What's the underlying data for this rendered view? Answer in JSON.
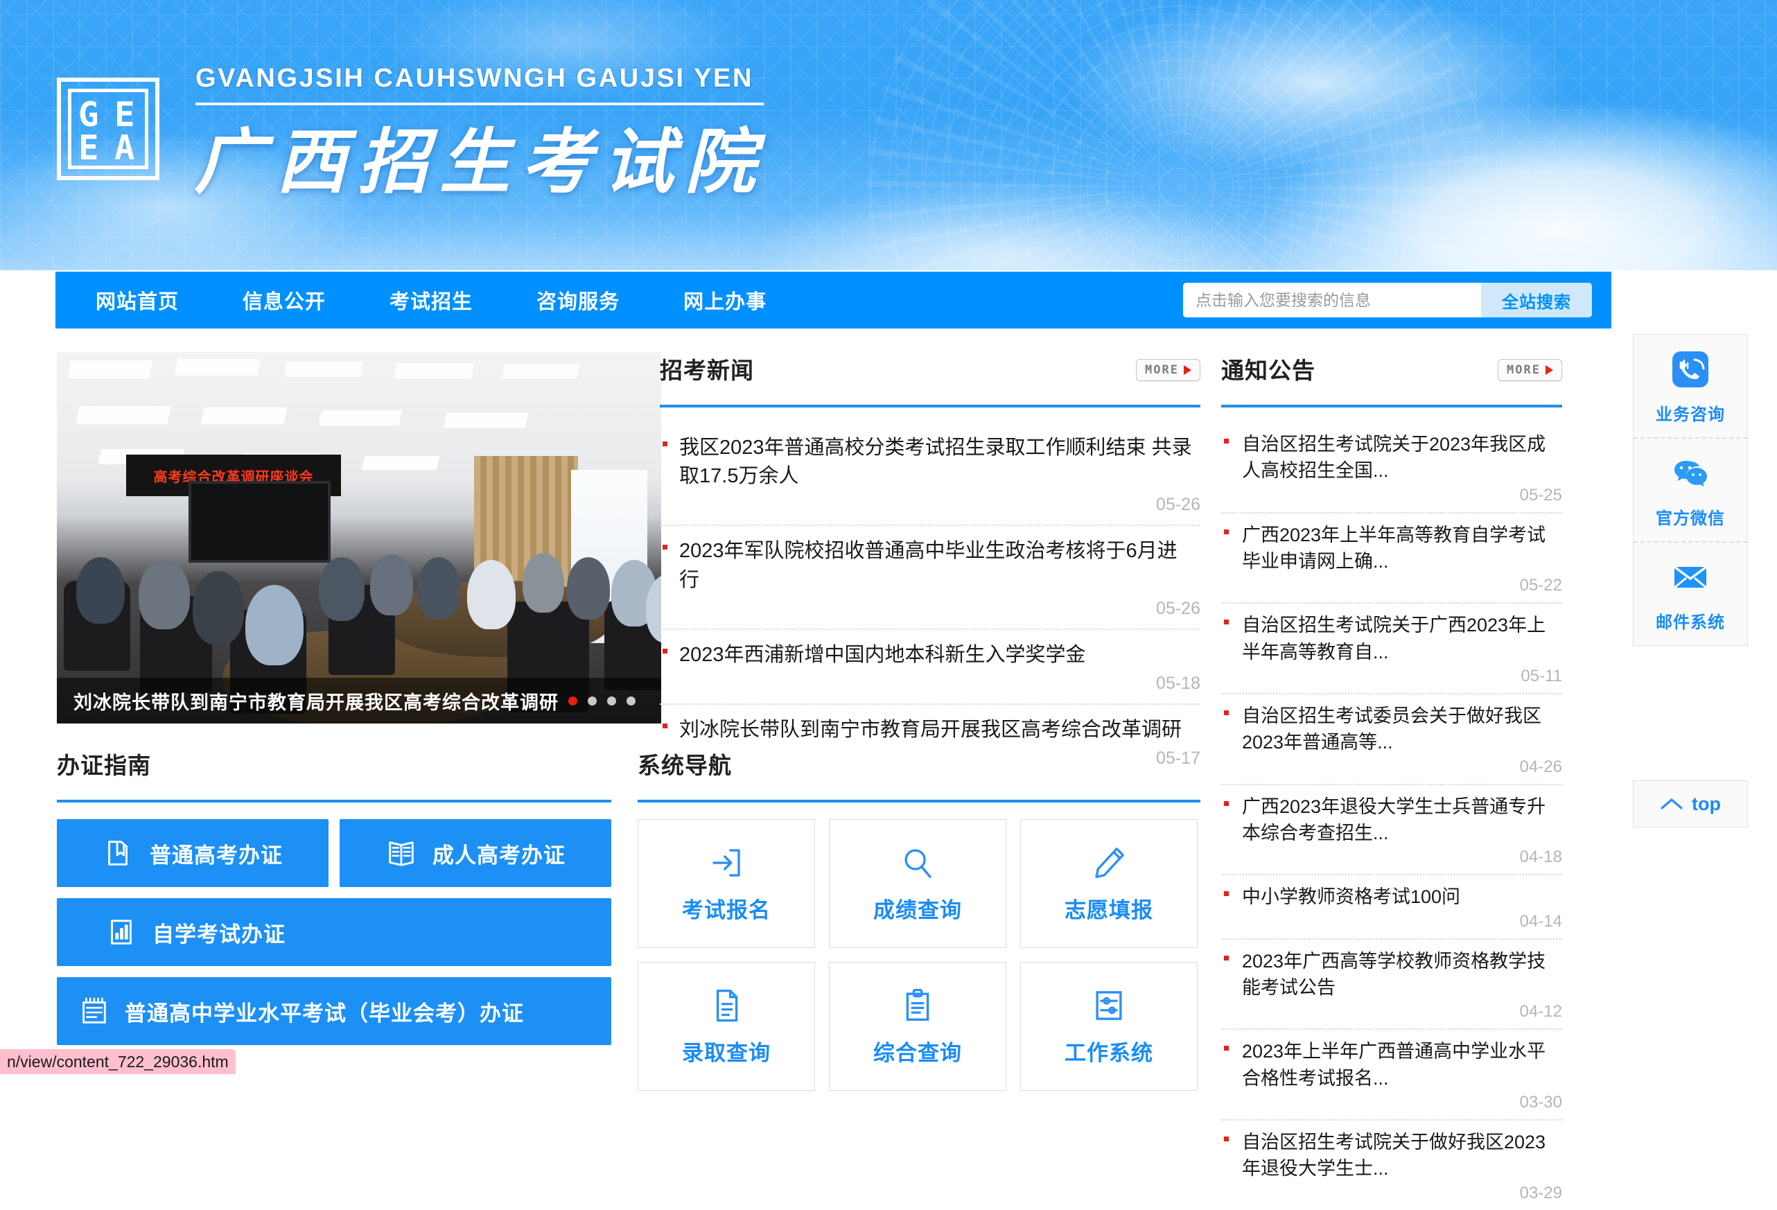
{
  "site": {
    "logo_text": "GEEA",
    "latin_title": "GVANGJSIH CAUHSWNGH GAUJSI YEN",
    "chinese_title": "广西招生考试院"
  },
  "nav": {
    "items": [
      {
        "label": "网站首页"
      },
      {
        "label": "信息公开"
      },
      {
        "label": "考试招生"
      },
      {
        "label": "咨询服务"
      },
      {
        "label": "网上办事"
      }
    ],
    "search": {
      "placeholder": "点击输入您要搜索的信息",
      "value": "",
      "button_label": "全站搜索"
    }
  },
  "carousel": {
    "caption": "刘冰院长带队到南宁市教育局开展我区高考综合改革调研",
    "banner_text": "高考综合改革调研座谈会",
    "dots": 4,
    "active_dot": 1
  },
  "news": {
    "title": "招考新闻",
    "more_label": "MORE",
    "items": [
      {
        "title": "我区2023年普通高校分类考试招生录取工作顺利结束 共录取17.5万余人",
        "date": "05-26"
      },
      {
        "title": "2023年军队院校招收普通高中毕业生政治考核将于6月进行",
        "date": "05-26"
      },
      {
        "title": "2023年西浦新增中国内地本科新生入学奖学金",
        "date": "05-18"
      },
      {
        "title": "刘冰院长带队到南宁市教育局开展我区高考综合改革调研",
        "date": "05-17"
      }
    ]
  },
  "notices": {
    "title": "通知公告",
    "more_label": "MORE",
    "items": [
      {
        "title": "自治区招生考试院关于2023年我区成人高校招生全国...",
        "date": "05-25"
      },
      {
        "title": "广西2023年上半年高等教育自学考试毕业申请网上确...",
        "date": "05-22"
      },
      {
        "title": "自治区招生考试院关于广西2023年上半年高等教育自...",
        "date": "05-11"
      },
      {
        "title": "自治区招生考试委员会关于做好我区2023年普通高等...",
        "date": "04-26"
      },
      {
        "title": "广西2023年退役大学生士兵普通专升本综合考查招生...",
        "date": "04-18"
      },
      {
        "title": "中小学教师资格考试100问",
        "date": "04-14"
      },
      {
        "title": "2023年广西高等学校教师资格教学技能考试公告",
        "date": "04-12"
      },
      {
        "title": "2023年上半年广西普通高中学业水平合格性考试报名...",
        "date": "03-30"
      },
      {
        "title": "自治区招生考试院关于做好我区2023年退役大学生士...",
        "date": "03-29"
      }
    ]
  },
  "cert_guide": {
    "title": "办证指南",
    "items": [
      {
        "label": "普通高考办证",
        "icon": "booklet-icon",
        "width": "half"
      },
      {
        "label": "成人高考办证",
        "icon": "open-book-icon",
        "width": "half"
      },
      {
        "label": "自学考试办证",
        "icon": "bar-chart-icon",
        "width": "full"
      },
      {
        "label": "普通高中学业水平考试（毕业会考）办证",
        "icon": "notepad-icon",
        "width": "full"
      }
    ]
  },
  "sys_nav": {
    "title": "系统导航",
    "items": [
      {
        "label": "考试报名",
        "icon": "login-arrow-icon"
      },
      {
        "label": "成绩查询",
        "icon": "search-icon"
      },
      {
        "label": "志愿填报",
        "icon": "pencil-icon"
      },
      {
        "label": "录取查询",
        "icon": "document-icon"
      },
      {
        "label": "综合查询",
        "icon": "clipboard-icon"
      },
      {
        "label": "工作系统",
        "icon": "sliders-icon"
      }
    ]
  },
  "float_widgets": {
    "items": [
      {
        "label": "业务咨询",
        "icon": "phone-icon"
      },
      {
        "label": "官方微信",
        "icon": "wechat-icon"
      },
      {
        "label": "邮件系统",
        "icon": "mail-icon"
      }
    ],
    "top_label": "top"
  },
  "status_bar": {
    "url": "n/view/content_722_29036.htm"
  },
  "colors": {
    "brand_blue": "#0090ff",
    "accent_blue": "#1d8ff0",
    "link_blue": "#1a8cf5",
    "red": "#e2231a",
    "date_gray": "#b5b5b5"
  }
}
